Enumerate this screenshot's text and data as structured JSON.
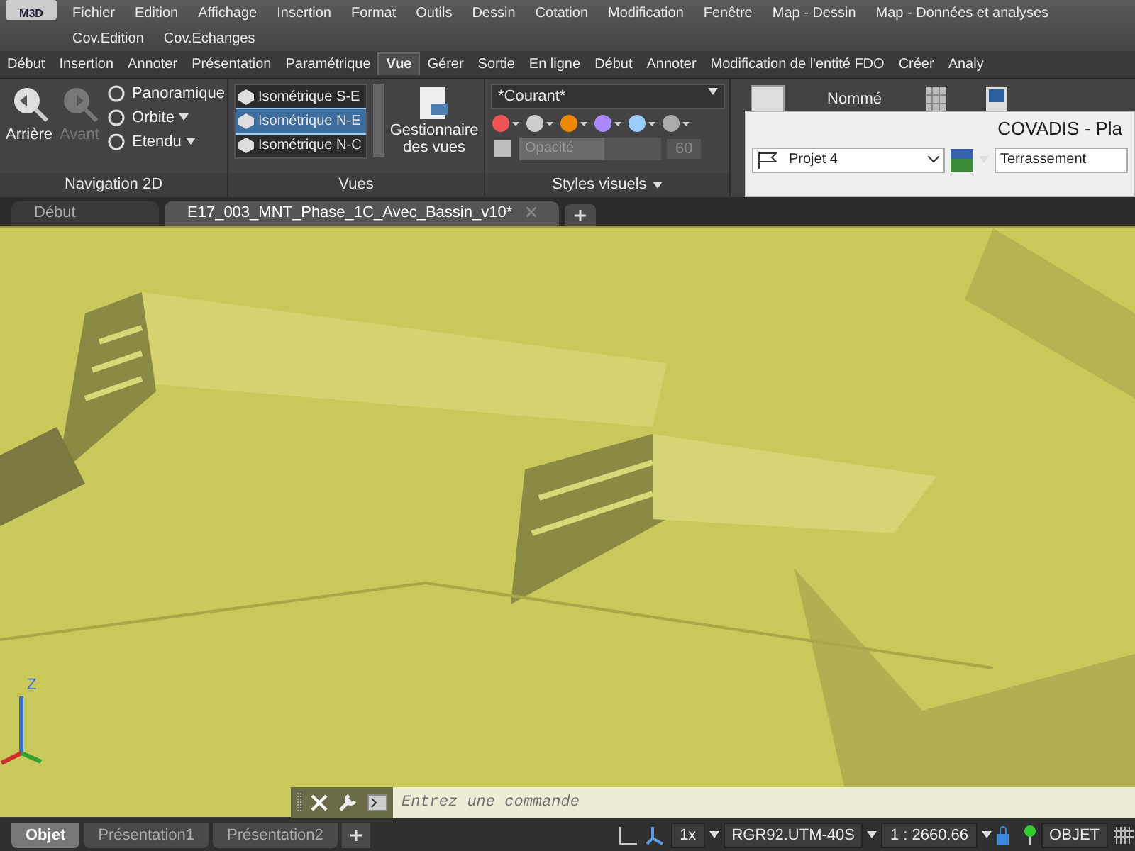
{
  "menu_rows": [
    [
      "Fichier",
      "Edition",
      "Affichage",
      "Insertion",
      "Format",
      "Outils",
      "Dessin",
      "Cotation",
      "Modification",
      "Fenêtre",
      "Map - Dessin",
      "Map - Données et analyses"
    ],
    [
      "Cov.Edition",
      "Cov.Echanges"
    ]
  ],
  "app_logo": "M3D",
  "ribbon_tabs": [
    {
      "label": "Début",
      "selected": false
    },
    {
      "label": "Insertion",
      "selected": false
    },
    {
      "label": "Annoter",
      "selected": false
    },
    {
      "label": "Présentation",
      "selected": false
    },
    {
      "label": "Paramétrique",
      "selected": false
    },
    {
      "label": "Vue",
      "selected": true
    },
    {
      "label": "Gérer",
      "selected": false
    },
    {
      "label": "Sortie",
      "selected": false
    },
    {
      "label": "En ligne",
      "selected": false
    },
    {
      "label": "Début",
      "selected": false
    },
    {
      "label": "Annoter",
      "selected": false
    },
    {
      "label": "Modification de l'entité FDO",
      "selected": false
    },
    {
      "label": "Créer",
      "selected": false
    },
    {
      "label": "Analy",
      "selected": false
    }
  ],
  "navigation": {
    "title": "Navigation 2D",
    "big_buttons": [
      {
        "label": "Arrière",
        "disabled": false
      },
      {
        "label": "Avant",
        "disabled": true
      }
    ],
    "tools": [
      "Panoramique",
      "Orbite",
      "Etendu"
    ]
  },
  "views": {
    "title": "Vues",
    "items": [
      {
        "label": "Isométrique S-E",
        "selected": false
      },
      {
        "label": "Isométrique N-E",
        "selected": true
      },
      {
        "label": "Isométrique N-C",
        "selected": false
      }
    ],
    "manager": "Gestionnaire des vues"
  },
  "visual_styles": {
    "title": "Styles visuels",
    "style": "*Courant*",
    "opacity_label": "Opacité",
    "level": 0.6,
    "opacity_value": "60"
  },
  "named_button": "Nommé",
  "covadis": {
    "title": "COVADIS - Pla",
    "project": "Projet 4",
    "category": "Terrassement"
  },
  "doc_tabs": [
    {
      "label": "Début",
      "selected": false
    },
    {
      "label": "E17_003_MNT_Phase_1C_Avec_Bassin_v10*",
      "selected": true
    }
  ],
  "ucs_label": "Z",
  "command_line": {
    "placeholder": "Entrez une commande"
  },
  "layout_tabs": [
    {
      "label": "Objet",
      "selected": true
    },
    {
      "label": "Présentation1",
      "selected": false
    },
    {
      "label": "Présentation2",
      "selected": false
    }
  ],
  "status": {
    "annotation_scale": "1x",
    "coordinate_system": "RGR92.UTM-40S",
    "scale": "1 : 2660.66",
    "space": "OBJET"
  }
}
